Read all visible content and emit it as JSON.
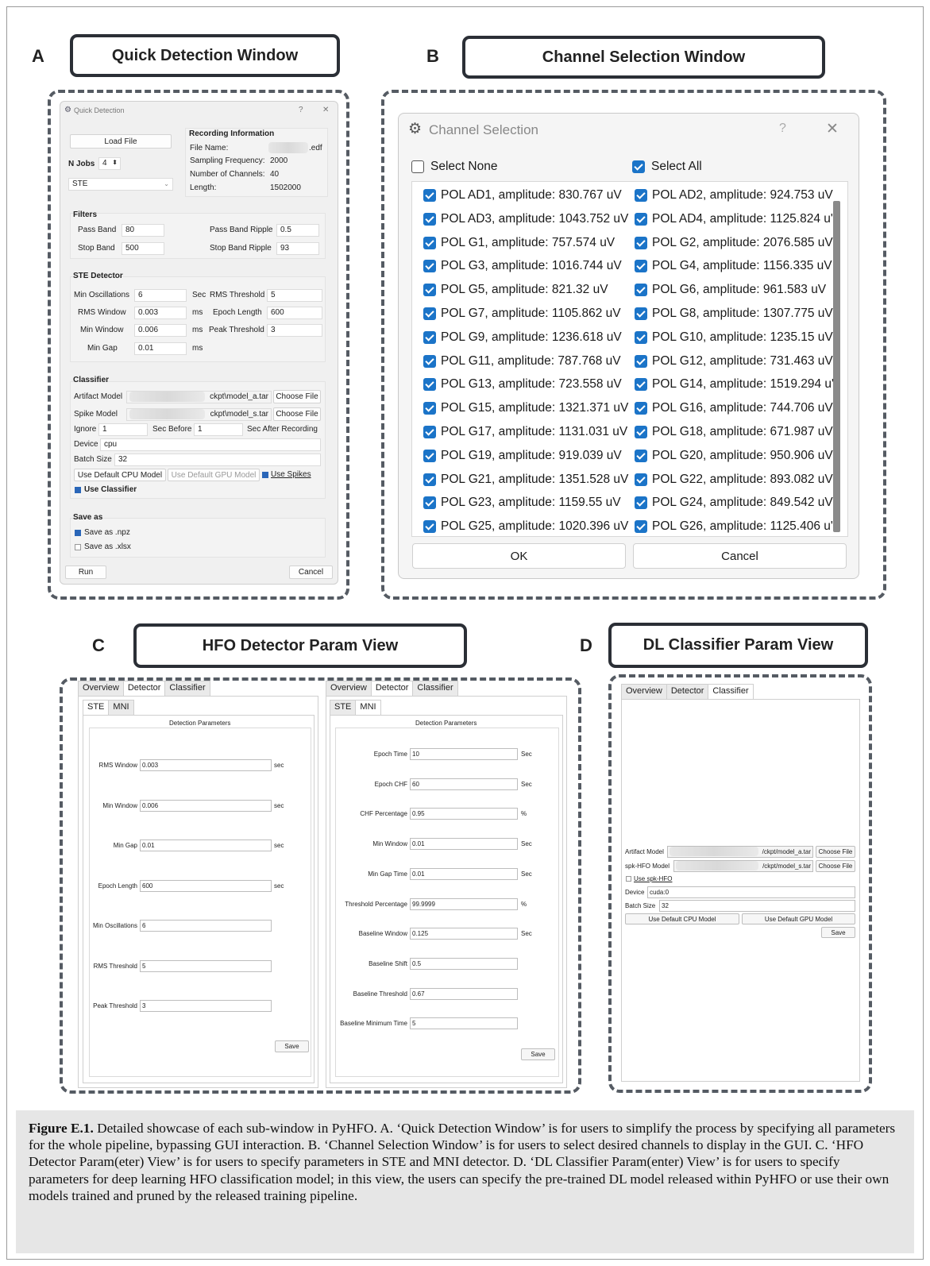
{
  "figure": {
    "panel_a": {
      "letter": "A",
      "title": "Quick Detection Window",
      "window_title": "Quick Detection",
      "help": "?",
      "close": "✕",
      "load_file": "Load File",
      "njobs_label": "N Jobs",
      "njobs_value": "4",
      "detector_select": "STE",
      "rec_info": {
        "heading": "Recording Information",
        "file_name_label": "File Name:",
        "file_ext": ".edf",
        "sampling_label": "Sampling Frequency:",
        "sampling_value": "2000",
        "channels_label": "Number of Channels:",
        "channels_value": "40",
        "length_label": "Length:",
        "length_value": "1502000"
      },
      "filters": {
        "heading": "Filters",
        "pass_band_label": "Pass Band",
        "pass_band": "80",
        "pass_ripple_label": "Pass Band Ripple",
        "pass_ripple": "0.5",
        "stop_band_label": "Stop Band",
        "stop_band": "500",
        "stop_ripple_label": "Stop Band Ripple",
        "stop_ripple": "93"
      },
      "ste": {
        "heading": "STE Detector",
        "min_osc_label": "Min Oscillations",
        "min_osc": "6",
        "sec_label": "Sec",
        "rms_thr_label": "RMS Threshold",
        "rms_thr": "5",
        "rms_win_label": "RMS Window",
        "rms_win": "0.003",
        "ms_label": "ms",
        "epoch_len_label": "Epoch Length",
        "epoch_len": "600",
        "min_win_label": "Min Window",
        "min_win": "0.006",
        "peak_thr_label": "Peak Threshold",
        "peak_thr": "3",
        "min_gap_label": "Min Gap",
        "min_gap": "0.01"
      },
      "classifier": {
        "heading": "Classifier",
        "artifact_label": "Artifact Model",
        "artifact_path": "ckpt\\model_a.tar",
        "spike_label": "Spike Model",
        "spike_path": "ckpt\\model_s.tar",
        "choose_file": "Choose File",
        "ignore_label": "Ignore",
        "ignore_before": "1",
        "sec_before": "Sec Before",
        "ignore_after": "1",
        "sec_after": "Sec After Recording",
        "device_label": "Device",
        "device": "cpu",
        "batch_label": "Batch Size",
        "batch": "32",
        "default_cpu": "Use Default CPU Model",
        "default_gpu": "Use Default GPU Model",
        "use_spikes": "Use Spikes",
        "use_classifier": "Use Classifier"
      },
      "save_as": {
        "heading": "Save as",
        "npz": "Save as .npz",
        "xlsx": "Save as .xlsx"
      },
      "run": "Run",
      "cancel": "Cancel"
    },
    "panel_b": {
      "letter": "B",
      "title": "Channel Selection Window",
      "window_title": "Channel Selection",
      "help": "?",
      "close": "✕",
      "select_none": "Select None",
      "select_all": "Select All",
      "rows": [
        [
          "POL AD1, amplitude: 830.767 uV",
          "POL AD2, amplitude: 924.753 uV"
        ],
        [
          "POL AD3, amplitude: 1043.752 uV",
          "POL AD4, amplitude: 1125.824 u'"
        ],
        [
          "POL G1, amplitude: 757.574 uV",
          "POL G2, amplitude: 2076.585 uV"
        ],
        [
          "POL G3, amplitude: 1016.744 uV",
          "POL G4, amplitude: 1156.335 uV"
        ],
        [
          "POL G5, amplitude: 821.32 uV",
          "POL G6, amplitude: 961.583 uV"
        ],
        [
          "POL G7, amplitude: 1105.862 uV",
          "POL G8, amplitude: 1307.775 uV"
        ],
        [
          "POL G9, amplitude: 1236.618 uV",
          "POL G10, amplitude: 1235.15 uV"
        ],
        [
          "POL G11, amplitude: 787.768 uV",
          "POL G12, amplitude: 731.463 uV"
        ],
        [
          "POL G13, amplitude: 723.558 uV",
          "POL G14, amplitude: 1519.294 u'"
        ],
        [
          "POL G15, amplitude: 1321.371 uV",
          "POL G16, amplitude: 744.706 uV"
        ],
        [
          "POL G17, amplitude: 1131.031 uV",
          "POL G18, amplitude: 671.987 uV"
        ],
        [
          "POL G19, amplitude: 919.039 uV",
          "POL G20, amplitude: 950.906 uV"
        ],
        [
          "POL G21, amplitude: 1351.528 uV",
          "POL G22, amplitude: 893.082 uV"
        ],
        [
          "POL G23, amplitude: 1159.55 uV",
          "POL G24, amplitude: 849.542 uV"
        ],
        [
          "POL G25, amplitude: 1020.396 uV",
          "POL G26, amplitude: 1125.406 u'"
        ]
      ],
      "ok": "OK",
      "cancel": "Cancel"
    },
    "panel_c": {
      "letter": "C",
      "title": "HFO Detector Param View",
      "tabs": [
        "Overview",
        "Detector",
        "Classifier"
      ],
      "subtabs": [
        "STE",
        "MNI"
      ],
      "section": "Detection Parameters",
      "ste_params": [
        {
          "label": "RMS Window",
          "value": "0.003",
          "unit": "sec"
        },
        {
          "label": "Min Window",
          "value": "0.006",
          "unit": "sec"
        },
        {
          "label": "Min Gap",
          "value": "0.01",
          "unit": "sec"
        },
        {
          "label": "Epoch Length",
          "value": "600",
          "unit": "sec"
        },
        {
          "label": "Min Oscillations",
          "value": "6",
          "unit": ""
        },
        {
          "label": "RMS Threshold",
          "value": "5",
          "unit": ""
        },
        {
          "label": "Peak Threshold",
          "value": "3",
          "unit": ""
        }
      ],
      "mni_params": [
        {
          "label": "Epoch Time",
          "value": "10",
          "unit": "Sec"
        },
        {
          "label": "Epoch CHF",
          "value": "60",
          "unit": "Sec"
        },
        {
          "label": "CHF Percentage",
          "value": "0.95",
          "unit": "%"
        },
        {
          "label": "Min Window",
          "value": "0.01",
          "unit": "Sec"
        },
        {
          "label": "Min Gap Time",
          "value": "0.01",
          "unit": "Sec"
        },
        {
          "label": "Threshold Percentage",
          "value": "99.9999",
          "unit": "%"
        },
        {
          "label": "Baseline Window",
          "value": "0.125",
          "unit": "Sec"
        },
        {
          "label": "Baseline Shift",
          "value": "0.5",
          "unit": ""
        },
        {
          "label": "Baseline Threshold",
          "value": "0.67",
          "unit": ""
        },
        {
          "label": "Baseline Minimum Time",
          "value": "5",
          "unit": ""
        }
      ],
      "save": "Save"
    },
    "panel_d": {
      "letter": "D",
      "title": "DL Classifier Param View",
      "tabs": [
        "Overview",
        "Detector",
        "Classifier"
      ],
      "artifact_label": "Artifact Model",
      "artifact_path": "/ckpt/model_a.tar",
      "spk_label": "spk-HFO Model",
      "spk_path": "/ckpt/model_s.tar",
      "choose_file": "Choose File",
      "use_spk": "Use spk-HFO",
      "device_label": "Device",
      "device": "cuda:0",
      "batch_label": "Batch Size",
      "batch": "32",
      "default_cpu": "Use Default CPU Model",
      "default_gpu": "Use Default GPU Model",
      "save": "Save"
    },
    "caption": {
      "label": "Figure E.1.",
      "text": " Detailed showcase of each sub-window in PyHFO. A. ‘Quick Detection Window’ is for users to simplify the process by specifying all parameters for the whole pipeline, bypassing GUI interaction. B. ‘Channel Selection Window’ is for users to select desired channels to display in the GUI. C. ‘HFO Detector Param(eter) View’ is for users to specify parameters in STE and MNI detector. D. ‘DL Classifier Param(enter) View’ is for users to specify parameters for deep learning HFO classification model; in this view, the users can specify the pre-trained DL model released within PyHFO or use their own models trained and pruned by the released training pipeline."
    }
  }
}
